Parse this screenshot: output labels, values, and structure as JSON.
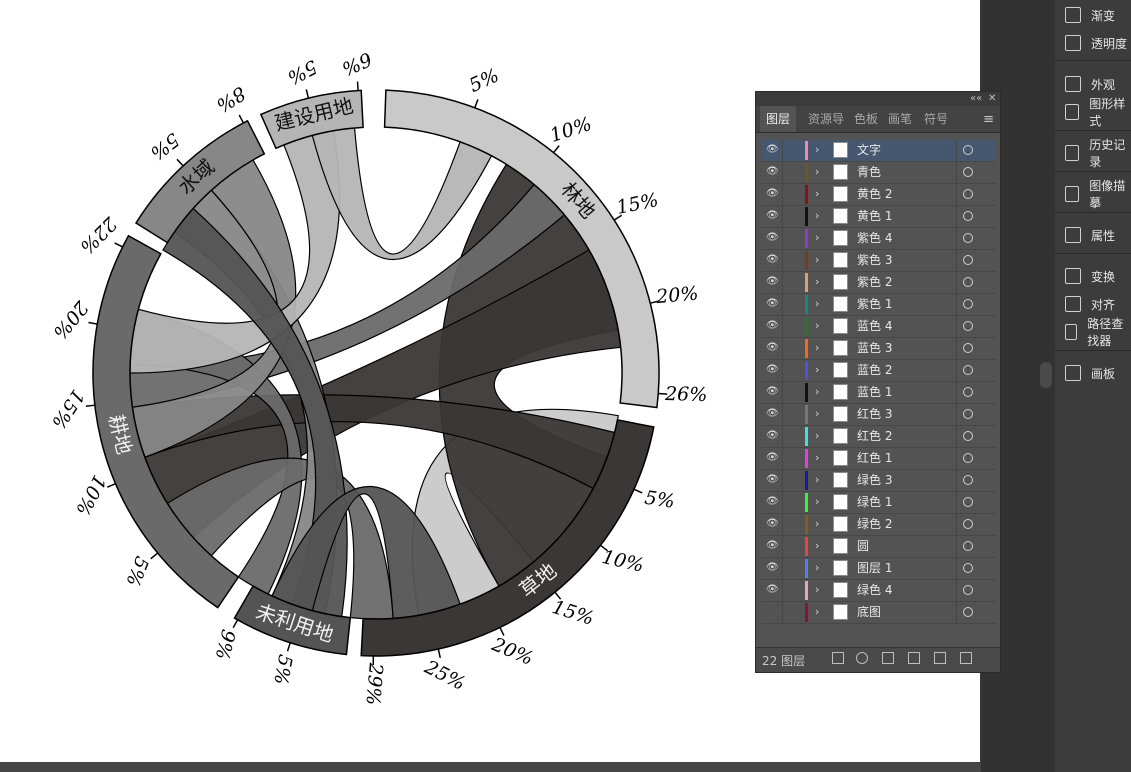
{
  "layers_panel": {
    "tabs": [
      "图层",
      "资源导",
      "色板",
      "画笔",
      "符号"
    ],
    "active_tab": "图层",
    "layers": [
      {
        "name": "文字",
        "color": "#f28ba8",
        "selected": true
      },
      {
        "name": "青色",
        "color": "#6b5a1a"
      },
      {
        "name": "黄色 2",
        "color": "#8b1010"
      },
      {
        "name": "黄色 1",
        "color": "#111111"
      },
      {
        "name": "紫色 4",
        "color": "#8a3ccf"
      },
      {
        "name": "紫色 3",
        "color": "#7a3b1b"
      },
      {
        "name": "紫色 2",
        "color": "#d9a070"
      },
      {
        "name": "紫色 1",
        "color": "#0f8a8a"
      },
      {
        "name": "蓝色 4",
        "color": "#1e7b1e"
      },
      {
        "name": "蓝色 3",
        "color": "#f26a1a"
      },
      {
        "name": "蓝色 2",
        "color": "#5050e0"
      },
      {
        "name": "蓝色 1",
        "color": "#111111"
      },
      {
        "name": "红色 3",
        "color": "#777777"
      },
      {
        "name": "红色 2",
        "color": "#40e0e0"
      },
      {
        "name": "红色 1",
        "color": "#e040e0"
      },
      {
        "name": "绿色 3",
        "color": "#1a1a9a"
      },
      {
        "name": "绿色 1",
        "color": "#40f040"
      },
      {
        "name": "绿色 2",
        "color": "#8a5a1a"
      },
      {
        "name": "圆",
        "color": "#f04040"
      },
      {
        "name": "图层 1",
        "color": "#5080f0"
      },
      {
        "name": "绿色 4",
        "color": "#f0a0c0"
      },
      {
        "name": "底图",
        "color": "#8a1040"
      }
    ],
    "footer_count": "22 图层",
    "window_controls": {
      "collapse": "««",
      "close": "✕"
    },
    "menu_icon": "≡",
    "eye_glyph": "👁",
    "expand_glyph": "›"
  },
  "right_panel": {
    "items": [
      "渐变",
      "透明度",
      "外观",
      "图形样式",
      "历史记录",
      "图像描摹",
      "属性",
      "变换",
      "对齐",
      "路径查找器",
      "画板"
    ]
  },
  "chart_data": {
    "type": "chord",
    "segments": [
      {
        "name": "林地",
        "ticks": [
          "5%",
          "10%",
          "15%",
          "20%",
          "26%"
        ]
      },
      {
        "name": "草地",
        "ticks": [
          "5%",
          "10%",
          "15%",
          "20%",
          "25%",
          "29%"
        ]
      },
      {
        "name": "未利用地",
        "ticks": [
          "5%",
          "9%"
        ]
      },
      {
        "name": "耕地",
        "ticks": [
          "5%",
          "10%",
          "15%",
          "20%",
          "22%"
        ]
      },
      {
        "name": "水域",
        "ticks": [
          "5%",
          "8%"
        ]
      },
      {
        "name": "建设用地",
        "ticks": [
          "5%",
          "6%"
        ]
      }
    ],
    "colors": {
      "林地": "#c8c9c8",
      "草地": "#3b3737",
      "未利用地": "#555454",
      "耕地": "#6a6a6a",
      "水域": "#878787",
      "建设用地": "#b5b5b5"
    }
  }
}
